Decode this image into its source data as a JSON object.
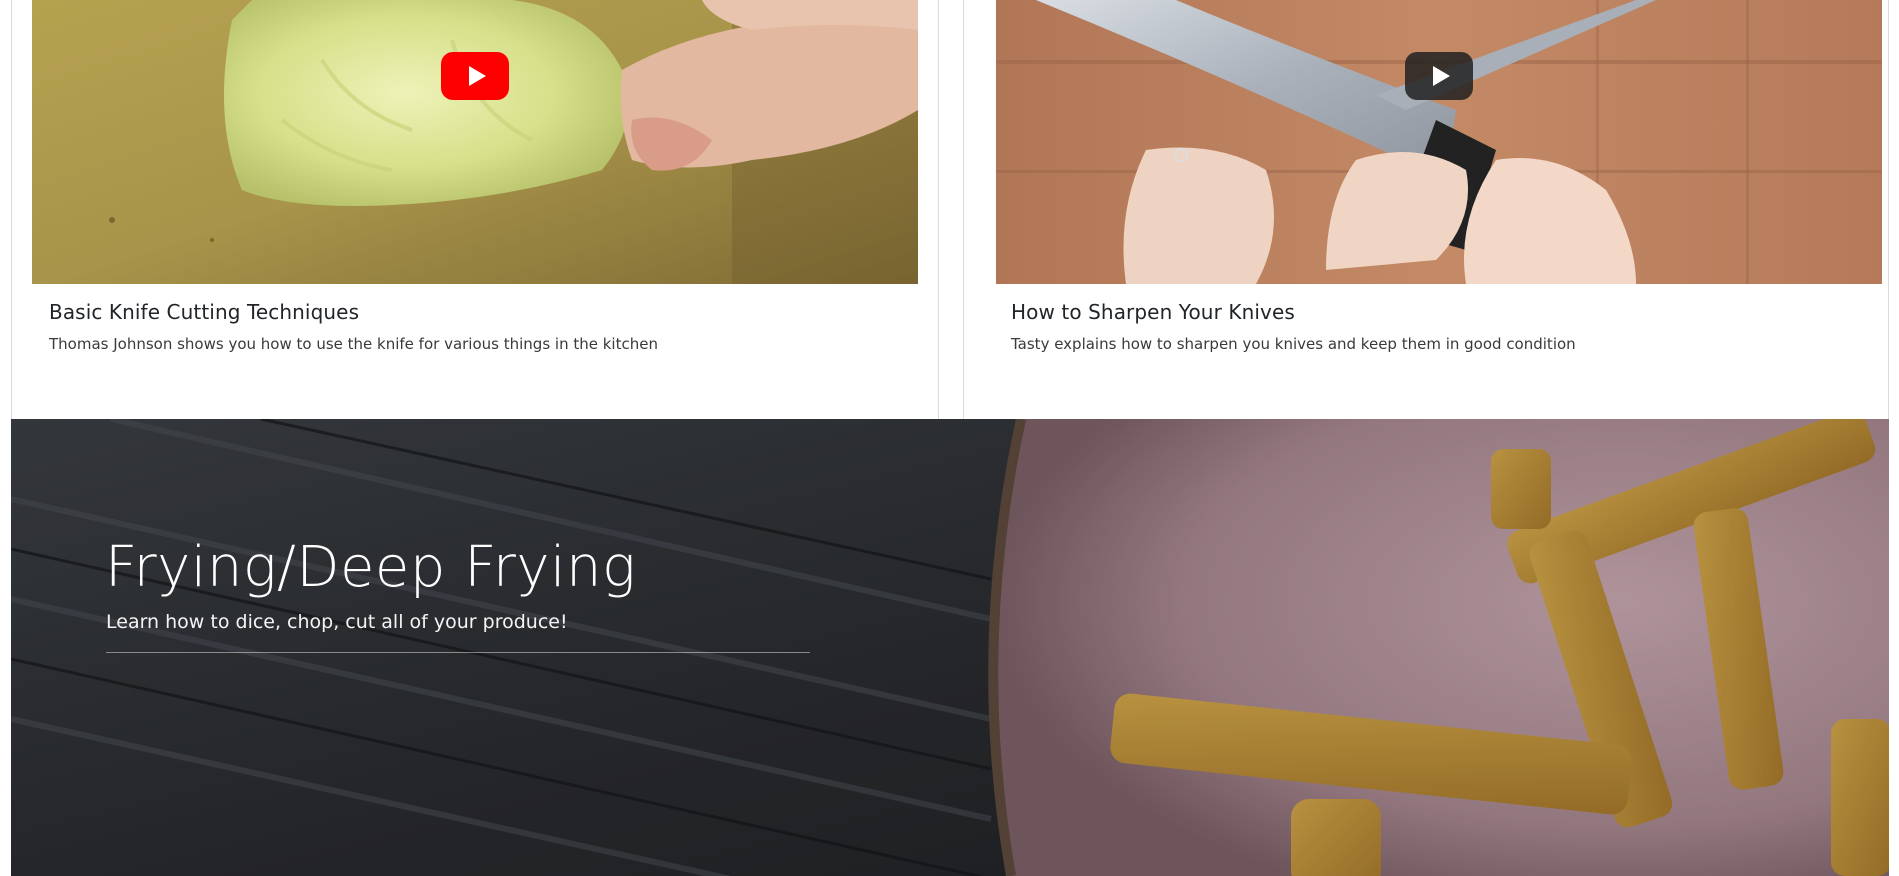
{
  "videos": [
    {
      "title": "Basic Knife Cutting Techniques",
      "description": "Thomas Johnson shows you how to use the knife for various things in the kitchen",
      "play_icon": "youtube-play-icon",
      "play_color": "#ff0000"
    },
    {
      "title": "How to Sharpen Your Knives",
      "description": "Tasty explains how to sharpen you knives and keep them in good condition",
      "play_icon": "youtube-play-icon",
      "play_color": "#212121"
    }
  ],
  "hero": {
    "title": "Frying/Deep Frying",
    "subtitle": "Learn how to dice, chop, cut all of your produce!"
  }
}
